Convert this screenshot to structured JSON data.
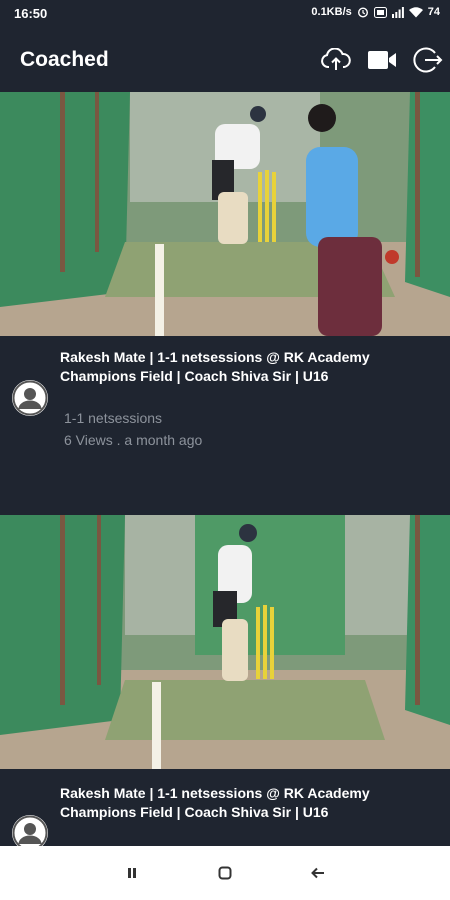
{
  "status": {
    "time": "16:50",
    "network_speed": "0.1KB/s",
    "battery": "74"
  },
  "header": {
    "title": "Coached",
    "actions": [
      {
        "icon": "cloud-upload-icon"
      },
      {
        "icon": "video-camera-icon"
      },
      {
        "icon": "logout-icon"
      }
    ]
  },
  "feed": [
    {
      "title": "Rakesh Mate | 1-1 netsessions @ RK Academy Champions Field | Coach Shiva Sir | U16",
      "subtitle": "1-1 netsessions",
      "meta": "6 Views . a month ago"
    },
    {
      "title": "Rakesh Mate | 1-1 netsessions @ RK Academy Champions Field | Coach Shiva Sir | U16"
    }
  ],
  "colors": {
    "background": "#1f2530",
    "text_primary": "#ffffff",
    "text_secondary": "#8d939c",
    "nav_bar": "#ffffff"
  },
  "nav": {
    "buttons": [
      "recents-icon",
      "home-icon",
      "back-icon"
    ]
  }
}
